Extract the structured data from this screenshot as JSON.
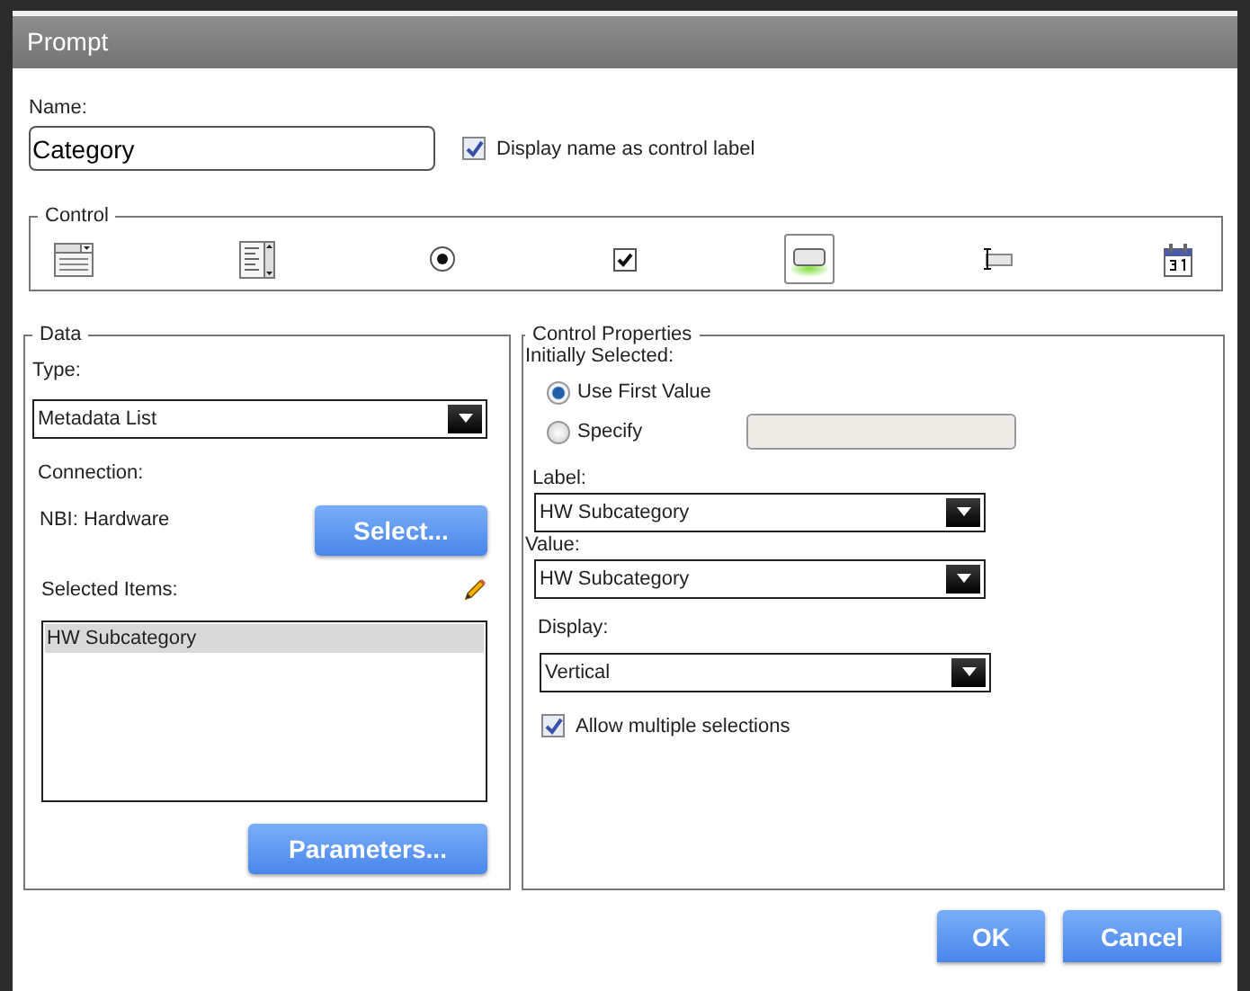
{
  "window": {
    "title": "Prompt"
  },
  "name": {
    "label": "Name:",
    "value": "Category",
    "display_as_label": {
      "label": "Display name as control label",
      "checked": true
    }
  },
  "control": {
    "legend": "Control",
    "options": [
      {
        "kind": "dropdown",
        "selected": false
      },
      {
        "kind": "listbox",
        "selected": false
      },
      {
        "kind": "radio",
        "selected": false
      },
      {
        "kind": "checkbox",
        "selected": false
      },
      {
        "kind": "button",
        "selected": true
      },
      {
        "kind": "textbox",
        "selected": false
      },
      {
        "kind": "calendar",
        "selected": false
      }
    ]
  },
  "data": {
    "legend": "Data",
    "type_label": "Type:",
    "type_value": "Metadata List",
    "connection_label": "Connection:",
    "connection_value": "NBI: Hardware",
    "select_button": "Select...",
    "selected_items_label": "Selected Items:",
    "selected_items": [
      {
        "label": "HW Subcategory",
        "selected": true
      }
    ],
    "parameters_button": "Parameters..."
  },
  "properties": {
    "legend": "Control Properties",
    "initially_selected_label": "Initially Selected:",
    "options": [
      {
        "label": "Use First Value",
        "selected": true
      },
      {
        "label": "Specify",
        "selected": false
      }
    ],
    "label_label": "Label:",
    "label_value": "HW Subcategory",
    "value_label": "Value:",
    "value_value": "HW Subcategory",
    "display_label": "Display:",
    "display_value": "Vertical",
    "allow_multiple": {
      "label": "Allow multiple selections",
      "checked": true
    }
  },
  "buttons": [
    "OK",
    "Cancel"
  ]
}
